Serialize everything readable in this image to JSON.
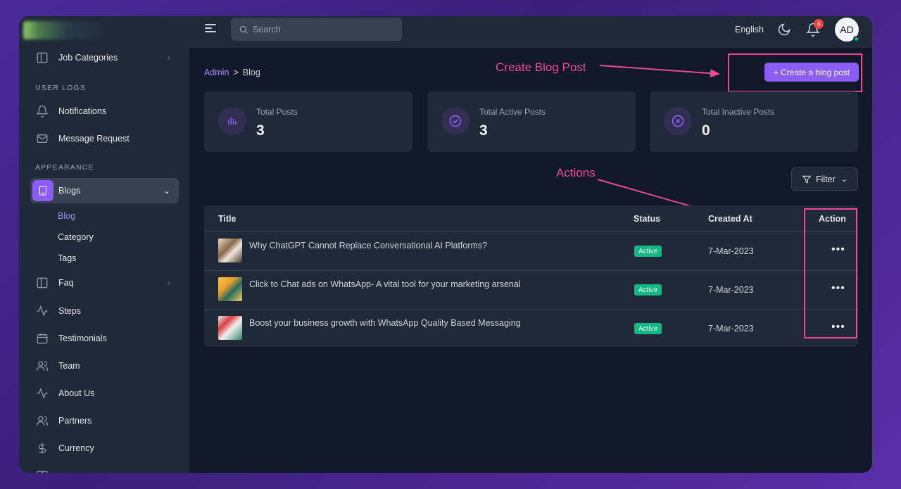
{
  "sidebar": {
    "items_top": [
      {
        "label": "Job Categories",
        "icon": "columns-icon"
      }
    ],
    "section_user_logs": "USER LOGS",
    "user_logs": [
      {
        "label": "Notifications",
        "icon": "bell-icon"
      },
      {
        "label": "Message Request",
        "icon": "mail-icon"
      }
    ],
    "section_appearance": "APPEARANCE",
    "blogs": {
      "label": "Blogs",
      "icon": "book-icon"
    },
    "blog_sub": [
      "Blog",
      "Category",
      "Tags"
    ],
    "items_bottom": [
      {
        "label": "Faq",
        "icon": "columns-icon"
      },
      {
        "label": "Steps",
        "icon": "activity-icon"
      },
      {
        "label": "Testimonials",
        "icon": "calendar-icon"
      },
      {
        "label": "Team",
        "icon": "users-icon"
      },
      {
        "label": "About Us",
        "icon": "activity-icon"
      },
      {
        "label": "Partners",
        "icon": "users-icon"
      },
      {
        "label": "Currency",
        "icon": "dollar-icon"
      }
    ]
  },
  "topbar": {
    "search_placeholder": "Search",
    "language": "English",
    "notification_count": "4",
    "avatar_initials": "AD"
  },
  "breadcrumb": {
    "root": "Admin",
    "sep": ">",
    "current": "Blog"
  },
  "create_button": "+ Create a blog post",
  "annotations": {
    "create": "Create Blog Post",
    "actions": "Actions"
  },
  "stats": [
    {
      "label": "Total Posts",
      "value": "3",
      "icon": "bar-chart-icon"
    },
    {
      "label": "Total Active Posts",
      "value": "3",
      "icon": "check-circle-icon"
    },
    {
      "label": "Total Inactive Posts",
      "value": "0",
      "icon": "x-circle-icon"
    }
  ],
  "filter_label": "Filter",
  "table": {
    "headers": {
      "title": "Title",
      "status": "Status",
      "created": "Created At",
      "action": "Action"
    },
    "rows": [
      {
        "title": "Why ChatGPT Cannot Replace Conversational AI Platforms?",
        "status": "Active",
        "created": "7-Mar-2023",
        "action": "•••"
      },
      {
        "title": "Click to Chat ads on WhatsApp- A vital tool for your marketing arsenal",
        "status": "Active",
        "created": "7-Mar-2023",
        "action": "•••"
      },
      {
        "title": "Boost your business growth with WhatsApp Quality Based Messaging",
        "status": "Active",
        "created": "7-Mar-2023",
        "action": "•••"
      }
    ]
  },
  "colors": {
    "accent": "#8b5cf6",
    "annotation": "#ec4899",
    "active": "#10b981"
  }
}
